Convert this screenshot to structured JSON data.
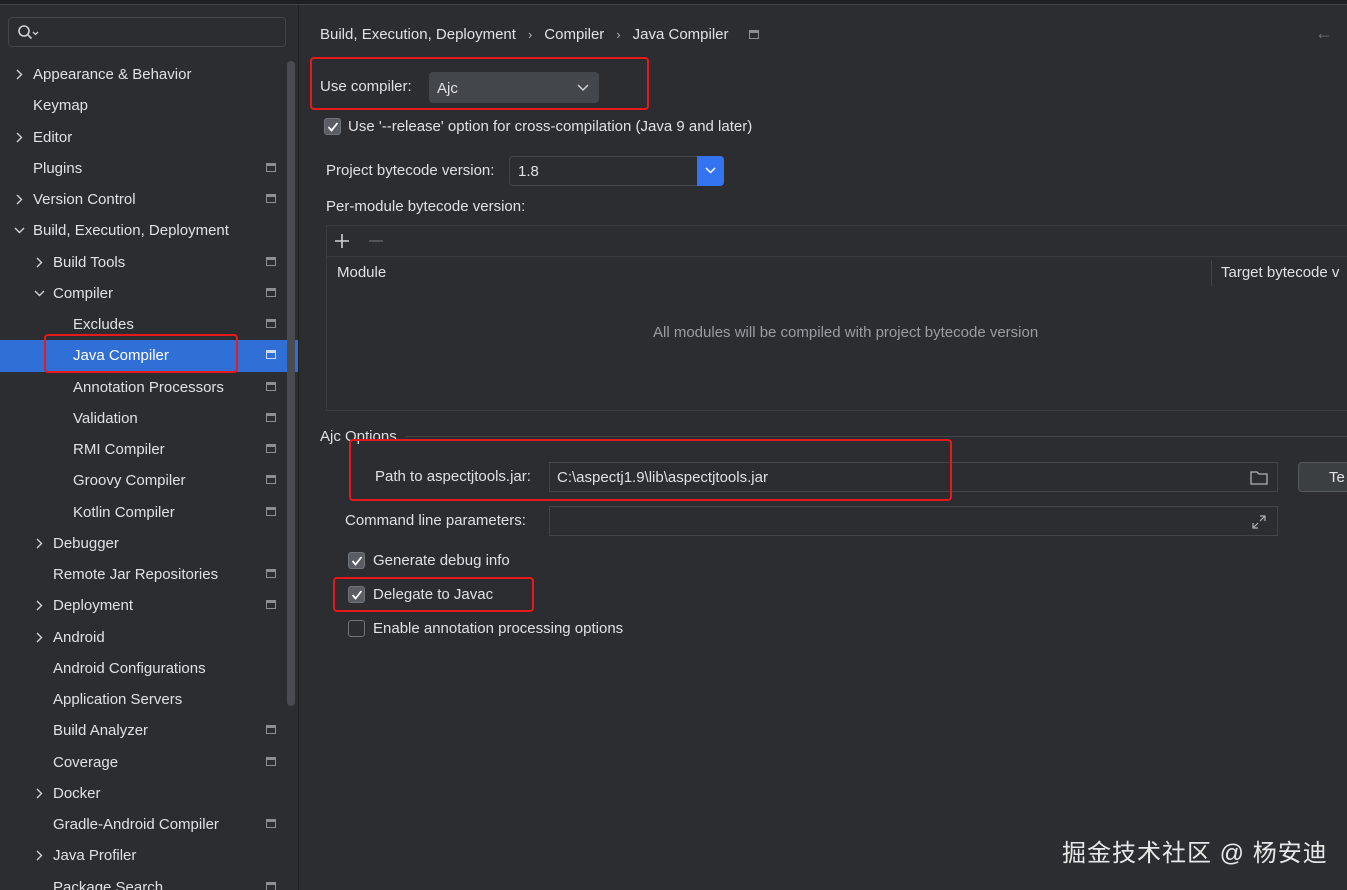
{
  "sidebar": {
    "items": [
      {
        "label": "Appearance & Behavior",
        "level": 0,
        "expandable": true,
        "expanded": false,
        "pinned": false
      },
      {
        "label": "Keymap",
        "level": 0,
        "expandable": false,
        "expanded": false,
        "pinned": false
      },
      {
        "label": "Editor",
        "level": 0,
        "expandable": true,
        "expanded": false,
        "pinned": false
      },
      {
        "label": "Plugins",
        "level": 0,
        "expandable": false,
        "expanded": false,
        "pinned": true
      },
      {
        "label": "Version Control",
        "level": 0,
        "expandable": true,
        "expanded": false,
        "pinned": true
      },
      {
        "label": "Build, Execution, Deployment",
        "level": 0,
        "expandable": true,
        "expanded": true,
        "pinned": false
      },
      {
        "label": "Build Tools",
        "level": 1,
        "expandable": true,
        "expanded": false,
        "pinned": true
      },
      {
        "label": "Compiler",
        "level": 1,
        "expandable": true,
        "expanded": true,
        "pinned": true
      },
      {
        "label": "Excludes",
        "level": 2,
        "expandable": false,
        "expanded": false,
        "pinned": true
      },
      {
        "label": "Java Compiler",
        "level": 2,
        "expandable": false,
        "expanded": false,
        "pinned": true,
        "selected": true
      },
      {
        "label": "Annotation Processors",
        "level": 2,
        "expandable": false,
        "expanded": false,
        "pinned": true
      },
      {
        "label": "Validation",
        "level": 2,
        "expandable": false,
        "expanded": false,
        "pinned": true
      },
      {
        "label": "RMI Compiler",
        "level": 2,
        "expandable": false,
        "expanded": false,
        "pinned": true
      },
      {
        "label": "Groovy Compiler",
        "level": 2,
        "expandable": false,
        "expanded": false,
        "pinned": true
      },
      {
        "label": "Kotlin Compiler",
        "level": 2,
        "expandable": false,
        "expanded": false,
        "pinned": true
      },
      {
        "label": "Debugger",
        "level": 1,
        "expandable": true,
        "expanded": false,
        "pinned": false
      },
      {
        "label": "Remote Jar Repositories",
        "level": 1,
        "expandable": false,
        "expanded": false,
        "pinned": true
      },
      {
        "label": "Deployment",
        "level": 1,
        "expandable": true,
        "expanded": false,
        "pinned": true
      },
      {
        "label": "Android",
        "level": 1,
        "expandable": true,
        "expanded": false,
        "pinned": false
      },
      {
        "label": "Android Configurations",
        "level": 1,
        "expandable": false,
        "expanded": false,
        "pinned": false
      },
      {
        "label": "Application Servers",
        "level": 1,
        "expandable": false,
        "expanded": false,
        "pinned": false
      },
      {
        "label": "Build Analyzer",
        "level": 1,
        "expandable": false,
        "expanded": false,
        "pinned": true
      },
      {
        "label": "Coverage",
        "level": 1,
        "expandable": false,
        "expanded": false,
        "pinned": true
      },
      {
        "label": "Docker",
        "level": 1,
        "expandable": true,
        "expanded": false,
        "pinned": false
      },
      {
        "label": "Gradle-Android Compiler",
        "level": 1,
        "expandable": false,
        "expanded": false,
        "pinned": true
      },
      {
        "label": "Java Profiler",
        "level": 1,
        "expandable": true,
        "expanded": false,
        "pinned": false
      },
      {
        "label": "Package Search",
        "level": 1,
        "expandable": false,
        "expanded": false,
        "pinned": true
      }
    ]
  },
  "breadcrumb": [
    "Build, Execution, Deployment",
    "Compiler",
    "Java Compiler"
  ],
  "compiler": {
    "label": "Use compiler:",
    "value": "Ajc"
  },
  "release_option": {
    "label": "Use '--release' option for cross-compilation (Java 9 and later)",
    "checked": true
  },
  "bytecode": {
    "label": "Project bytecode version:",
    "value": "1.8"
  },
  "per_module": {
    "label": "Per-module bytecode version:",
    "columns": [
      "Module",
      "Target bytecode v"
    ],
    "empty_text": "All modules will be compiled with project bytecode version"
  },
  "ajc": {
    "section_title": "Ajc Options",
    "path_label": "Path to aspectjtools.jar:",
    "path_value": "C:\\aspectj1.9\\lib\\aspectjtools.jar",
    "test_button": "Te",
    "cmd_label": "Command line parameters:",
    "cmd_value": "",
    "options": [
      {
        "label": "Generate debug info",
        "checked": true
      },
      {
        "label": "Delegate to Javac",
        "checked": true
      },
      {
        "label": "Enable annotation processing options",
        "checked": false
      }
    ]
  },
  "watermark": "掘金技术社区 @ 杨安迪",
  "colors": {
    "selection": "#2f6fd6",
    "highlight": "#e8191a",
    "accent": "#3574f0"
  }
}
